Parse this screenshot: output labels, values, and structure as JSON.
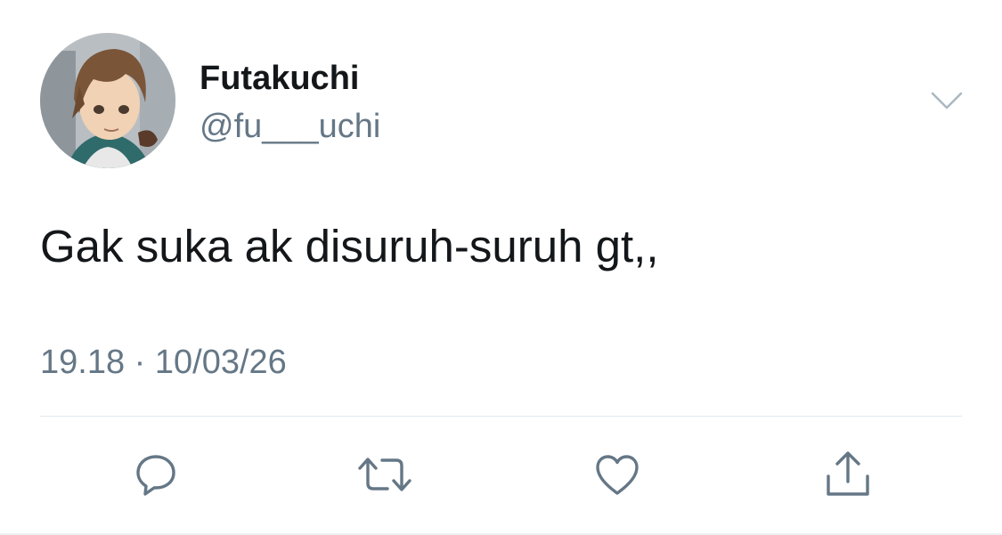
{
  "tweet": {
    "author": {
      "display_name": "Futakuchi",
      "handle": "@fu___uchi"
    },
    "text": "Gak suka ak disuruh-suruh gt,,",
    "timestamp": "19.18 · 10/03/26"
  },
  "actions": {
    "reply_icon": "reply-icon",
    "retweet_icon": "retweet-icon",
    "like_icon": "heart-icon",
    "share_icon": "share-icon"
  },
  "colors": {
    "text_primary": "#14171a",
    "text_secondary": "#657786",
    "icon": "#657786",
    "divider": "#e1e8ed"
  }
}
